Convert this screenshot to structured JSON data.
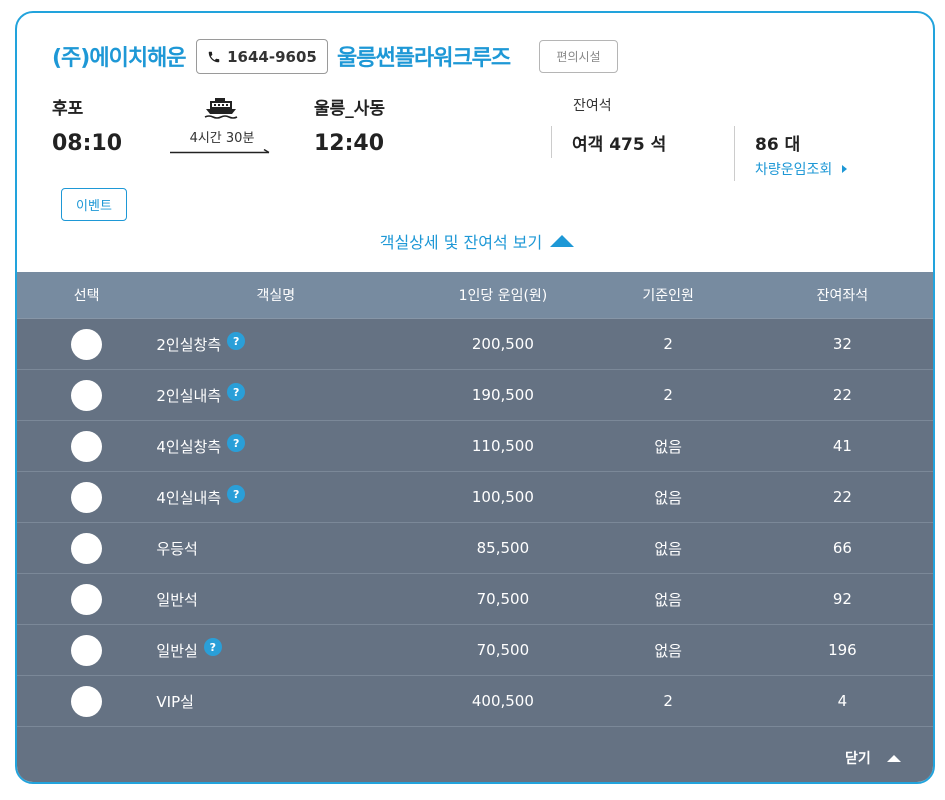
{
  "header": {
    "company": "(주)에이치해운",
    "phone": "1644-9605",
    "ship_name": "울릉썬플라워크루즈",
    "facility_label": "편의시설"
  },
  "route": {
    "departure_port": "후포",
    "departure_time": "08:10",
    "duration": "4시간 30분",
    "arrival_port": "울릉_사동",
    "arrival_time": "12:40"
  },
  "availability": {
    "label": "잔여석",
    "passenger": "여객 475 석",
    "vehicles": "86 대",
    "vehicle_link": "차량운임조회"
  },
  "event_label": "이벤트",
  "detail_toggle_label": "객실상세 및 잔여석 보기",
  "table": {
    "headers": [
      "선택",
      "객실명",
      "1인당 운임(원)",
      "기준인원",
      "잔여좌석"
    ],
    "rows": [
      {
        "name": "2인실창측",
        "fare": "200,500",
        "base": "2",
        "remain": "32",
        "help": true
      },
      {
        "name": "2인실내측",
        "fare": "190,500",
        "base": "2",
        "remain": "22",
        "help": true
      },
      {
        "name": "4인실창측",
        "fare": "110,500",
        "base": "없음",
        "remain": "41",
        "help": true
      },
      {
        "name": "4인실내측",
        "fare": "100,500",
        "base": "없음",
        "remain": "22",
        "help": true
      },
      {
        "name": "우등석",
        "fare": "85,500",
        "base": "없음",
        "remain": "66",
        "help": false
      },
      {
        "name": "일반석",
        "fare": "70,500",
        "base": "없음",
        "remain": "92",
        "help": false
      },
      {
        "name": "일반실",
        "fare": "70,500",
        "base": "없음",
        "remain": "196",
        "help": true
      },
      {
        "name": "VIP실",
        "fare": "400,500",
        "base": "2",
        "remain": "4",
        "help": false
      }
    ]
  },
  "close_label": "닫기",
  "colors": {
    "accent": "#1e98d6",
    "table_bg": "#657283",
    "table_header_bg": "#778ba0"
  }
}
